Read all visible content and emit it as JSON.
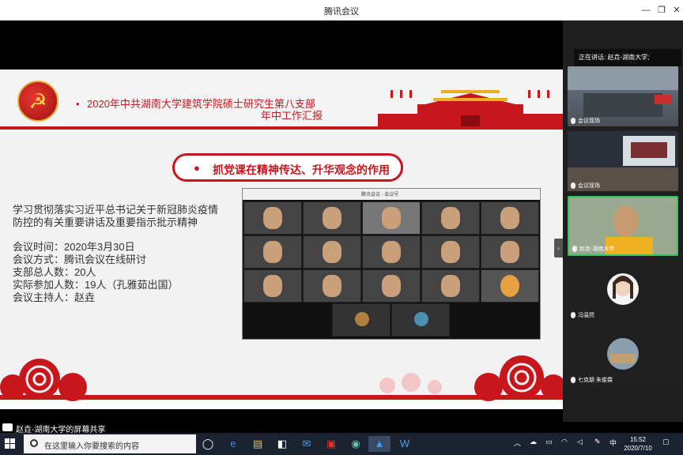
{
  "window": {
    "title": "腾讯会议",
    "minimize": "—",
    "restore": "❐",
    "close": "✕"
  },
  "slide": {
    "emblem": "☭",
    "title_bullet": "•",
    "title_line1": "2020年中共湖南大学建筑学院硕士研究生第八支部",
    "title_line2": "年中工作汇报",
    "section_bullet": "●",
    "section_title": "抓党课在精神传达、升华观念的作用",
    "paragraph": "学习贯彻落实习近平总书记关于新冠肺炎疫情防控的有关重要讲话及重要指示批示精神",
    "info": [
      "会议时间：2020年3月30日",
      "会议方式：腾讯会议在线研讨",
      "支部总人数：20人",
      "实际参加人数：19人（孔雅茹出国）",
      "会议主持人：赵垚"
    ]
  },
  "embedded_screenshot": {
    "caption": "腾讯会议 - 会议号"
  },
  "right_panel": {
    "speaking_label": "正在讲话: 赵垚-湖南大学;",
    "tiles": [
      {
        "name": "会议现场"
      },
      {
        "name": "会议现场"
      },
      {
        "name": "赵垚-湖南大学"
      },
      {
        "name": "冯温然"
      },
      {
        "name": "七克朋 朱俊霖"
      }
    ]
  },
  "share_bar": {
    "text": "赵垚-湖南大学的屏幕共享"
  },
  "taskbar": {
    "search_placeholder": "在这里输入你要搜索的内容",
    "ime": "中",
    "time": "15:52",
    "date": "2020/7/10"
  },
  "colors": {
    "accent_red": "#c8161d",
    "taskbar_bg": "#1b2330"
  }
}
